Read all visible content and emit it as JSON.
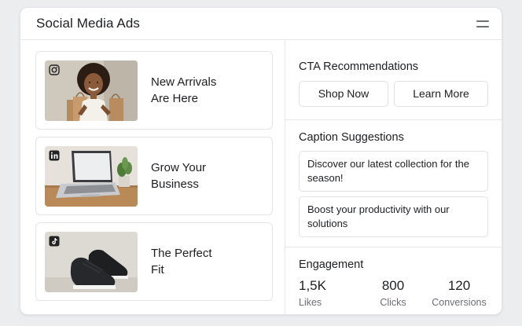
{
  "header": {
    "title": "Social Media Ads",
    "menu_icon": "menu-icon"
  },
  "ads": [
    {
      "platform": "instagram",
      "platform_icon": "instagram-icon",
      "image": "woman-with-shopping-bags",
      "line1": "New Arrivals",
      "line2": "Are Here"
    },
    {
      "platform": "linkedin",
      "platform_icon": "linkedin-icon",
      "image": "laptop-on-desk",
      "line1": "Grow Your",
      "line2": "Business"
    },
    {
      "platform": "tiktok",
      "platform_icon": "tiktok-icon",
      "image": "black-sneakers",
      "line1": "The Perfect",
      "line2": "Fit"
    }
  ],
  "cta": {
    "title": "CTA Recommendations",
    "buttons": [
      "Shop Now",
      "Learn More"
    ]
  },
  "captions": {
    "title": "Caption Suggestions",
    "items": [
      "Discover our latest collection for the season!",
      "Boost your productivity with our solutions"
    ]
  },
  "engagement": {
    "title": "Engagement",
    "stats": [
      {
        "value": "1,5K",
        "label": "Likes"
      },
      {
        "value": "800",
        "label": "Clicks"
      },
      {
        "value": "120",
        "label": "Conversions"
      }
    ]
  },
  "colors": {
    "background": "#ecedef",
    "card": "#ffffff",
    "border": "#e4e5e8",
    "text": "#1d1f22",
    "muted": "#6a6e75"
  }
}
